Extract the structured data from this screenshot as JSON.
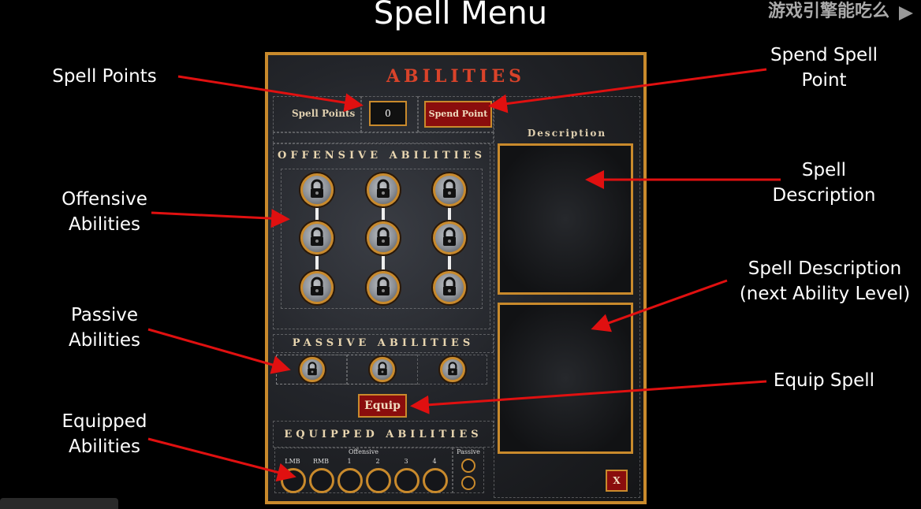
{
  "slide": {
    "title": "Spell Menu"
  },
  "watermark": {
    "text": "游戏引擎能吃么"
  },
  "callouts": {
    "spell_points": "Spell Points",
    "offensive": [
      "Offensive",
      "Abilities"
    ],
    "passive": [
      "Passive",
      "Abilities"
    ],
    "equipped": [
      "Equipped",
      "Abilities"
    ],
    "spend": [
      "Spend Spell",
      "Point"
    ],
    "description": [
      "Spell",
      "Description"
    ],
    "next_description": [
      "Spell Description",
      "(next Ability Level)"
    ],
    "equip": "Equip Spell"
  },
  "panel": {
    "title": "ABILITIES",
    "spell_points_label": "Spell Points",
    "spell_points_value": "0",
    "spend_button": "Spend Point",
    "description_label": "Description",
    "offensive_title": "OFFENSIVE ABILITIES",
    "passive_title": "PASSIVE ABILITIES",
    "equip_button": "Equip",
    "equipped_title": "EQUIPPED ABILITIES",
    "offensive_group_label": "Offensive",
    "passive_group_label": "Passive",
    "slot_labels": [
      "LMB",
      "RMB",
      "1",
      "2",
      "3",
      "4"
    ],
    "close_button": "X"
  },
  "colors": {
    "accent_gold": "#c98a2c",
    "button_red": "#8a0d0d",
    "arrow_red": "#e01010",
    "title_red": "#d9432a"
  },
  "icons": {
    "locked_ability": "lock-icon"
  }
}
